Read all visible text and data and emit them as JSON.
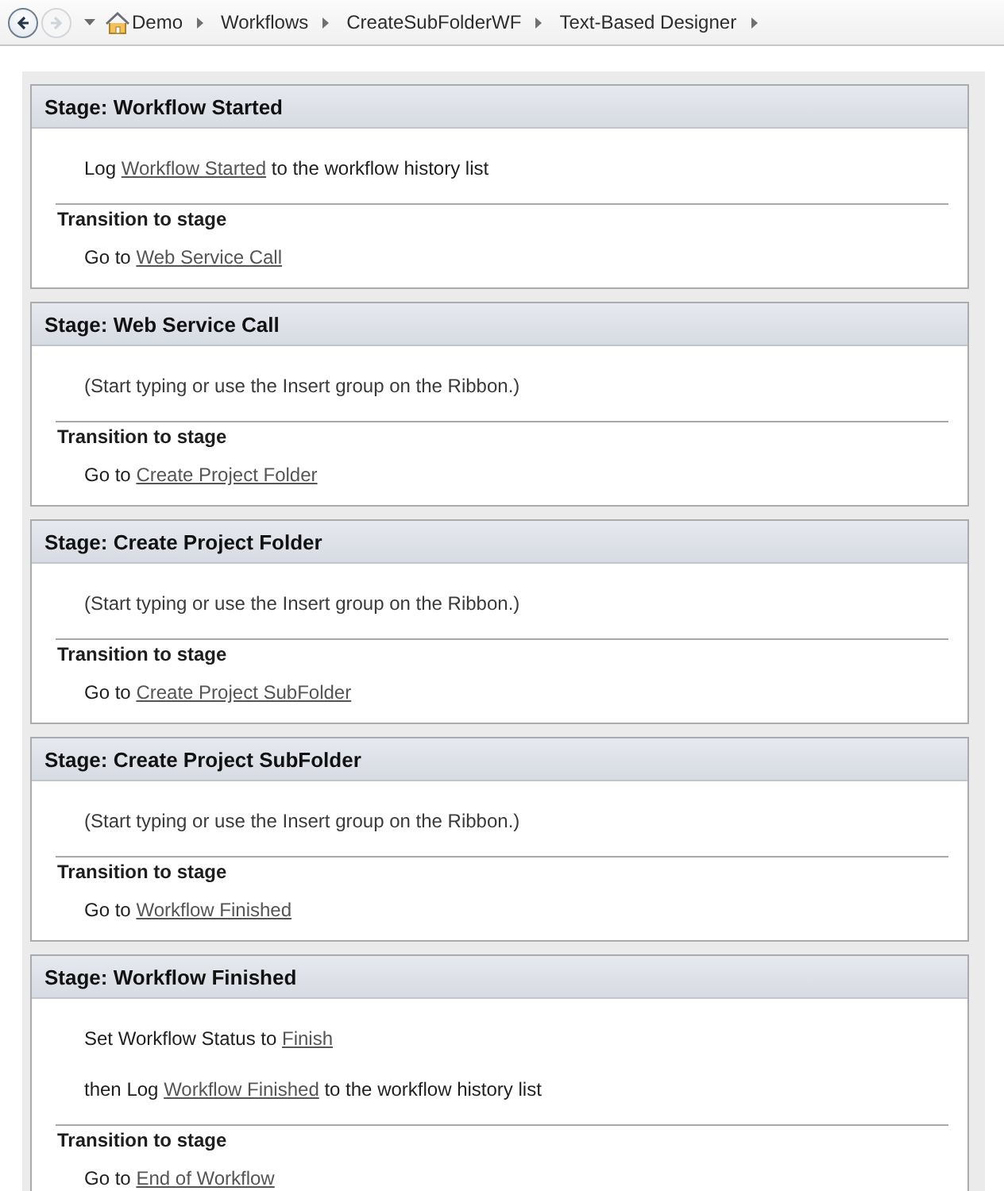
{
  "breadcrumb": {
    "nav_buttons": [
      {
        "kind": "back",
        "disabled": false
      },
      {
        "kind": "forward",
        "disabled": true
      }
    ],
    "items": [
      "Demo",
      "Workflows",
      "CreateSubFolderWF",
      "Text-Based Designer"
    ]
  },
  "stages": [
    {
      "title": "Stage: Workflow Started",
      "actions": [
        {
          "kind": "action",
          "before": "Log",
          "link": "Workflow Started",
          "after": "to the workflow history list"
        }
      ],
      "transition": {
        "heading": "Transition to stage",
        "before": "Go to",
        "link": "Web Service Call"
      }
    },
    {
      "title": "Stage: Web Service Call",
      "actions": [
        {
          "kind": "placeholder",
          "text": "(Start typing or use the Insert group on the Ribbon.)"
        }
      ],
      "transition": {
        "heading": "Transition to stage",
        "before": "Go to",
        "link": "Create Project Folder"
      }
    },
    {
      "title": "Stage: Create Project Folder",
      "actions": [
        {
          "kind": "placeholder",
          "text": "(Start typing or use the Insert group on the Ribbon.)"
        }
      ],
      "transition": {
        "heading": "Transition to stage",
        "before": "Go to",
        "link": "Create Project SubFolder"
      }
    },
    {
      "title": "Stage: Create Project SubFolder",
      "actions": [
        {
          "kind": "placeholder",
          "text": "(Start typing or use the Insert group on the Ribbon.)"
        }
      ],
      "transition": {
        "heading": "Transition to stage",
        "before": "Go to",
        "link": "Workflow Finished"
      }
    },
    {
      "title": "Stage: Workflow Finished",
      "actions": [
        {
          "kind": "action",
          "before": "Set Workflow Status to",
          "link": "Finish"
        },
        {
          "kind": "action",
          "before": "then Log",
          "link": "Workflow Finished",
          "after": "to the workflow history list"
        }
      ],
      "transition": {
        "heading": "Transition to stage",
        "before": "Go to",
        "link": "End of Workflow"
      }
    }
  ]
}
